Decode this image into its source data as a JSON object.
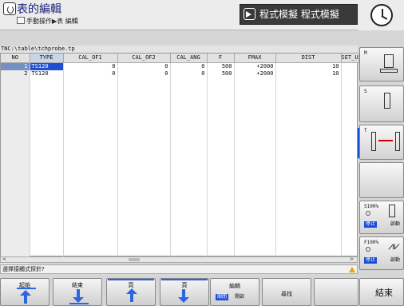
{
  "header": {
    "title": "表的編輯",
    "subtitle": "手動操作▶表 編輯",
    "mode_text": "程式模擬 程式模擬"
  },
  "path": "TNC:\\table\\tchprobe.tp",
  "table": {
    "columns": [
      "NO",
      "TYPE",
      "CAL_OF1",
      "CAL_OF2",
      "CAL_ANG",
      "F",
      "FMAX",
      "DIST",
      "SET_UP"
    ],
    "rows": [
      [
        "1",
        "TS120",
        "0",
        "0",
        "0",
        "500",
        "+2000",
        "10",
        ""
      ],
      [
        "2",
        "TS120",
        "0",
        "0",
        "0",
        "500",
        "+2000",
        "10",
        ""
      ]
    ],
    "selected_row": 0
  },
  "status_text": "選擇接觸式探針?",
  "side_keys": {
    "m_label": "M",
    "s_label": "S",
    "t_label": "T",
    "spindle_pct": "S100%",
    "feed_pct": "F100%",
    "stop_label": "停止",
    "start_label": "啟動",
    "end_label": "結束"
  },
  "bottom_keys": {
    "begin": "起始",
    "end": "結束",
    "page_up": "頁",
    "page_down": "頁",
    "edit": "編輯",
    "edit_off": "關閉",
    "edit_on": "開啟",
    "find": "尋找"
  },
  "colors": {
    "accent": "#2c65e0",
    "selection": "#1f4fd0"
  }
}
